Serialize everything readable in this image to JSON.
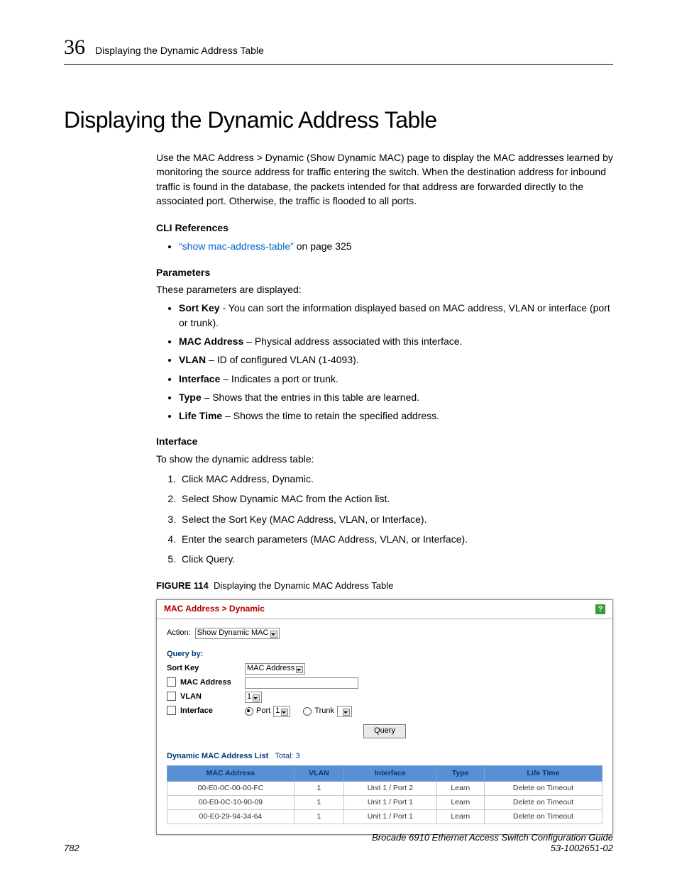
{
  "header": {
    "chapter": "36",
    "running": "Displaying the Dynamic Address Table"
  },
  "title": "Displaying the Dynamic Address Table",
  "intro": "Use the MAC Address > Dynamic (Show Dynamic MAC) page to display the MAC addresses learned by monitoring the source address for traffic entering the switch. When the destination address for inbound traffic is found in the database, the packets intended for that address are forwarded directly to the associated port. Otherwise, the traffic is flooded to all ports.",
  "cli": {
    "heading": "CLI References",
    "link": "“show mac-address-table”",
    "suffix": " on page 325"
  },
  "params": {
    "heading": "Parameters",
    "lead": "These parameters are displayed:",
    "items": [
      {
        "term": "Sort Key",
        "desc": " - You can sort the information displayed based on MAC address, VLAN or interface (port or trunk)."
      },
      {
        "term": "MAC Address",
        "desc": " – Physical address associated with this interface."
      },
      {
        "term": "VLAN",
        "desc": " – ID of configured VLAN (1-4093)."
      },
      {
        "term": "Interface",
        "desc": " – Indicates a port or trunk."
      },
      {
        "term": "Type",
        "desc": " – Shows that the entries in this table are learned."
      },
      {
        "term": "Life Time",
        "desc": " – Shows the time to retain the specified address."
      }
    ]
  },
  "iface": {
    "heading": "Interface",
    "lead": "To show the dynamic address table:",
    "steps": [
      "Click MAC Address, Dynamic.",
      "Select Show Dynamic MAC from the Action list.",
      "Select the Sort Key (MAC Address, VLAN, or Interface).",
      "Enter the search parameters (MAC Address, VLAN, or Interface).",
      "Click Query."
    ]
  },
  "figure": {
    "num": "FIGURE 114",
    "cap": "Displaying the Dynamic MAC Address Table"
  },
  "shot": {
    "breadcrumb": "MAC Address > Dynamic",
    "help": "?",
    "action_lbl": "Action:",
    "action_val": "Show Dynamic MAC",
    "query_by": "Query by:",
    "rows": {
      "sortkey": {
        "lbl": "Sort Key",
        "val": "MAC Address"
      },
      "mac": {
        "lbl": "MAC Address"
      },
      "vlan": {
        "lbl": "VLAN",
        "val": "1"
      },
      "iface": {
        "lbl": "Interface",
        "port_lbl": "Port",
        "port_val": "1",
        "trunk_lbl": "Trunk"
      }
    },
    "query_btn": "Query",
    "list_hdr": "Dynamic MAC Address List",
    "total_lbl": "Total:",
    "total_val": "3",
    "cols": [
      "MAC Address",
      "VLAN",
      "Interface",
      "Type",
      "Life Time"
    ],
    "data": [
      [
        "00-E0-0C-00-00-FC",
        "1",
        "Unit 1 / Port 2",
        "Learn",
        "Delete on Timeout"
      ],
      [
        "00-E0-0C-10-90-09",
        "1",
        "Unit 1 / Port 1",
        "Learn",
        "Delete on Timeout"
      ],
      [
        "00-E0-29-94-34-64",
        "1",
        "Unit 1 / Port 1",
        "Learn",
        "Delete on Timeout"
      ]
    ]
  },
  "footer": {
    "page": "782",
    "book": "Brocade 6910 Ethernet Access Switch Configuration Guide",
    "docnum": "53-1002651-02"
  }
}
